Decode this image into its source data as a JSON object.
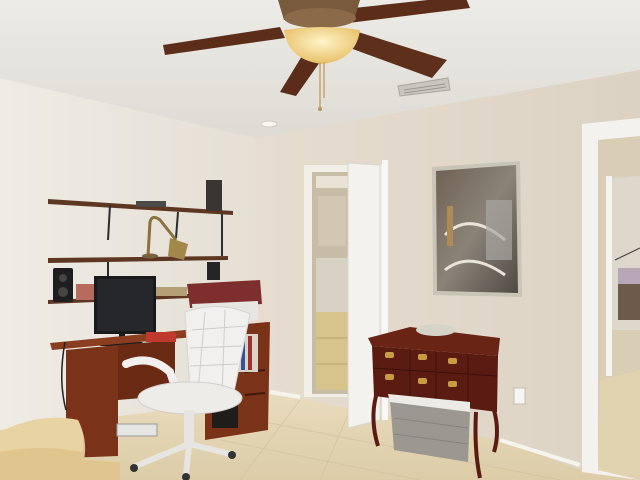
{
  "scene": {
    "kind": "photo",
    "colors": {
      "ceiling": "#e9e7e2",
      "wall_left": "#ebe7df",
      "wall_back": "#e2d9cc",
      "floor": "#e3d6b8",
      "fan_blade": "#5c2e1a",
      "fan_light": "#f2d488",
      "desk_wood": "#7a3219",
      "chest_wood": "#5a1c12",
      "chair_white": "#f1f0ee",
      "sofa": "#e0c58e",
      "door_white": "#f4f2ee",
      "picture_frame": "#c9c4b8",
      "monitor": "#1a1a1c",
      "basket": "#9a9890"
    },
    "objects": [
      "ceiling-fan",
      "air-vent",
      "wall-shelves",
      "desk-lamp",
      "speakers",
      "computer-monitor",
      "wooden-desk",
      "office-chair",
      "sofa-armrest",
      "closet",
      "framed-picture",
      "wooden-chest",
      "storage-basket",
      "hallway-doorway"
    ]
  }
}
